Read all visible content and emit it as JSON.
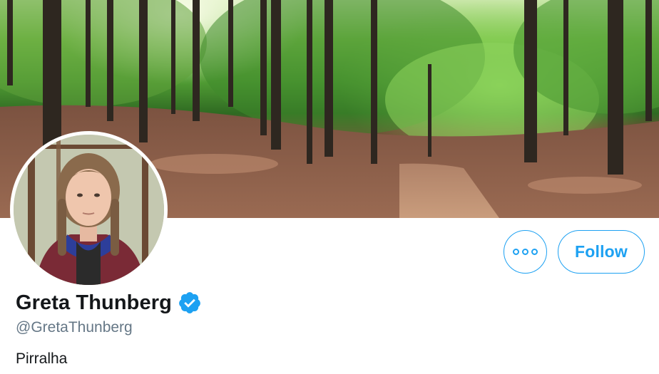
{
  "profile": {
    "display_name": "Greta Thunberg",
    "handle": "@GretaThunberg",
    "bio": "Pirralha",
    "verified": true
  },
  "actions": {
    "more_icon": "more-horizontal-icon",
    "follow_label": "Follow"
  },
  "colors": {
    "accent": "#1da1f2",
    "name_text": "#14171a",
    "handle_text": "#657786",
    "background": "#ffffff"
  }
}
